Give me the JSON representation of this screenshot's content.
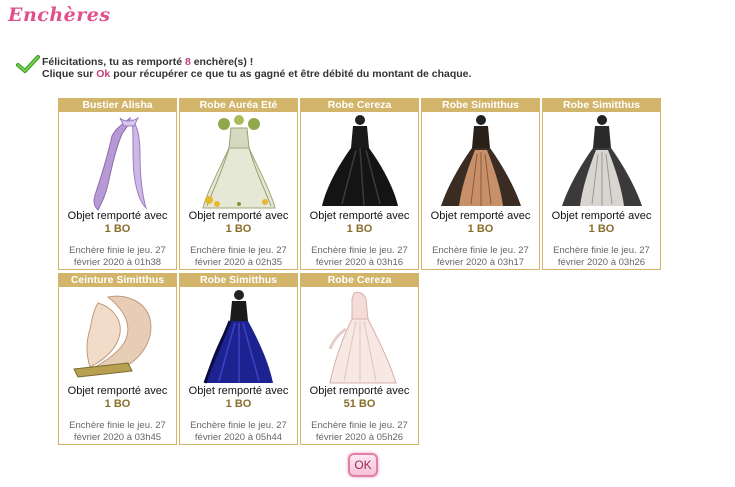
{
  "header": {
    "title": "Enchères"
  },
  "message": {
    "line1_pre": "Félicitations, tu as remporté ",
    "line1_count": "8",
    "line1_post": " enchère(s) !",
    "line2_pre": "Clique sur ",
    "line2_ok": "Ok",
    "line2_post": " pour récupérer ce que tu as gagné et être débité du montant de chaque."
  },
  "auctions": [
    {
      "name": "Bustier Alisha",
      "won_label": "Objet remporté avec",
      "price": "1 BO",
      "ended_line1": "Enchère finie le jeu. 27",
      "ended_line2": "février 2020 à 01h38",
      "item_icon": "lilac-scarf"
    },
    {
      "name": "Robe Auréa Eté",
      "won_label": "Objet remporté avec",
      "price": "1 BO",
      "ended_line1": "Enchère finie le jeu. 27",
      "ended_line2": "février 2020 à 02h35",
      "item_icon": "floral-gown"
    },
    {
      "name": "Robe Cereza",
      "won_label": "Objet remporté avec",
      "price": "1 BO",
      "ended_line1": "Enchère finie le jeu. 27",
      "ended_line2": "février 2020 à 03h16",
      "item_icon": "black-gown"
    },
    {
      "name": "Robe Simitthus",
      "won_label": "Objet remporté avec",
      "price": "1 BO",
      "ended_line1": "Enchère finie le jeu. 27",
      "ended_line2": "février 2020 à 03h17",
      "item_icon": "lace-gown-bronze"
    },
    {
      "name": "Robe Simitthus",
      "won_label": "Objet remporté avec",
      "price": "1 BO",
      "ended_line1": "Enchère finie le jeu. 27",
      "ended_line2": "février 2020 à 03h26",
      "item_icon": "lace-gown-silver"
    },
    {
      "name": "Ceinture Simitthus",
      "won_label": "Objet remporté avec",
      "price": "1 BO",
      "ended_line1": "Enchère finie le jeu. 27",
      "ended_line2": "février 2020 à 03h45",
      "item_icon": "silk-belt"
    },
    {
      "name": "Robe Simitthus",
      "won_label": "Objet remporté avec",
      "price": "1 BO",
      "ended_line1": "Enchère finie le jeu. 27",
      "ended_line2": "février 2020 à 05h44",
      "item_icon": "blue-gown"
    },
    {
      "name": "Robe Cereza",
      "won_label": "Objet remporté avec",
      "price": "51 BO",
      "ended_line1": "Enchère finie le jeu. 27",
      "ended_line2": "février 2020 à 05h26",
      "item_icon": "pink-gown"
    }
  ],
  "footer": {
    "ok_label": "OK"
  },
  "colors": {
    "title": "#e0508a",
    "card_header": "#d2b56a",
    "price": "#8a6d2a",
    "ok_border": "#e080a8"
  }
}
